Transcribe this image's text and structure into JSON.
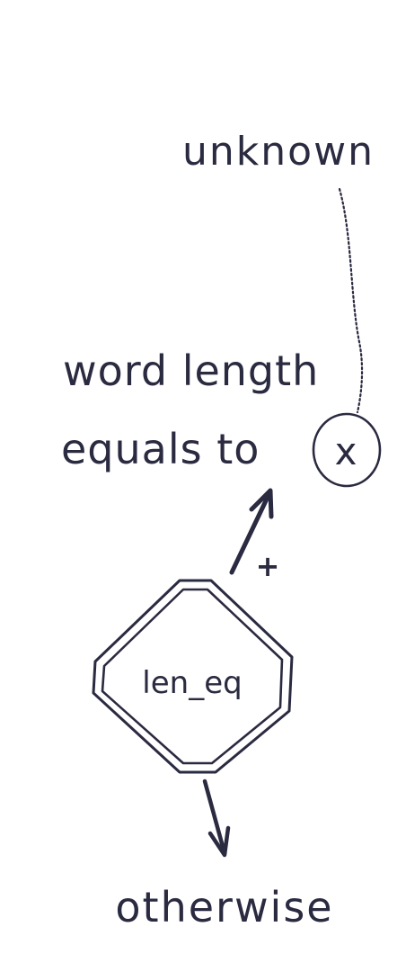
{
  "diagram": {
    "top_label": "unknown",
    "condition_line1": "word length",
    "condition_line2": "equals to",
    "variable": "x",
    "node_label": "len_eq",
    "positive_branch_sign": "+",
    "bottom_label": "otherwise",
    "ink_color": "#2a2a40"
  }
}
